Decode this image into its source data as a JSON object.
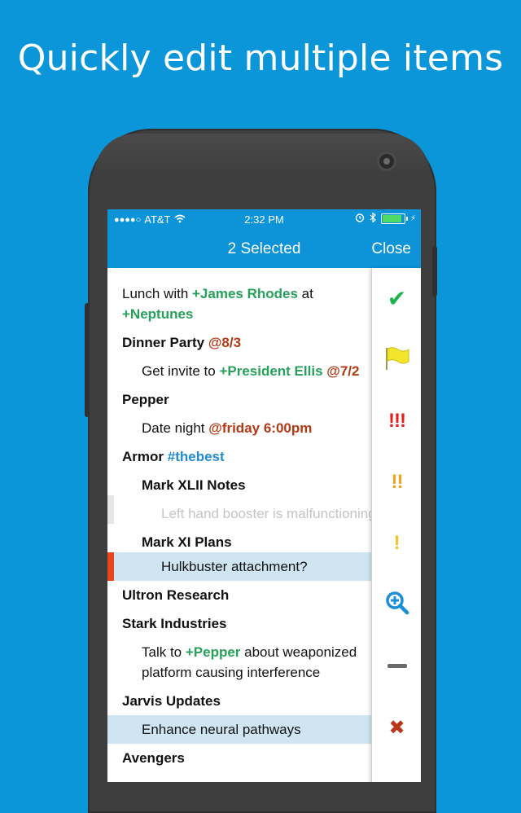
{
  "headline": "Quickly edit multiple items",
  "status": {
    "carrier": "AT&T",
    "time": "2:32 PM",
    "battery_level": 0.9,
    "signal_icon": "signal-dots-icon",
    "wifi_icon": "wifi-icon",
    "alarm_icon": "alarm-icon",
    "bluetooth_icon": "bluetooth-icon"
  },
  "nav": {
    "title": "2 Selected",
    "close": "Close"
  },
  "colors": {
    "accent": "#0c93d8",
    "background": "#0a96d9",
    "contact": "#26a05a",
    "date": "#b13a14",
    "tag": "#1f8bd0",
    "selected_row": "#cfe6f2",
    "marker": "#e8451e"
  },
  "items": {
    "r0": {
      "a": "Lunch with ",
      "b": "+James Rhodes",
      "c": " at"
    },
    "r0b": {
      "a": "+Neptunes"
    },
    "r1": {
      "a": "Dinner Party ",
      "b": "@8/3"
    },
    "r2": {
      "a": "Get invite to ",
      "b": "+President Ellis",
      "c": " @7/2"
    },
    "r3": {
      "a": "Pepper"
    },
    "r4": {
      "a": "Date night ",
      "b": "@friday 6:00pm"
    },
    "r5": {
      "a": "Armor ",
      "b": "#thebest"
    },
    "r6": {
      "a": "Mark XLII Notes"
    },
    "r7": {
      "a": "Left hand booster is malfunctioning"
    },
    "r8": {
      "a": "Mark XI Plans"
    },
    "r9": {
      "a": "Hulkbuster attachment?"
    },
    "r10": {
      "a": "Ultron Research"
    },
    "r11": {
      "a": "Stark Industries"
    },
    "r12": {
      "a": "Talk to ",
      "b": "+Pepper",
      "c": " about weaponized"
    },
    "r12b": {
      "a": "platform causing interference"
    },
    "r13": {
      "a": "Jarvis Updates"
    },
    "r14": {
      "a": "Enhance neural pathways"
    },
    "r15": {
      "a": "Avengers"
    }
  },
  "sidebar": {
    "check": {
      "icon": "checkmark-icon",
      "symbol": "✔"
    },
    "flag": {
      "icon": "flag-icon"
    },
    "p3": {
      "icon": "priority-high-icon",
      "symbol": "!!!"
    },
    "p2": {
      "icon": "priority-medium-icon",
      "symbol": "!!"
    },
    "p1": {
      "icon": "priority-low-icon",
      "symbol": "!"
    },
    "zoom": {
      "icon": "zoom-in-icon"
    },
    "minus": {
      "icon": "minus-icon"
    },
    "delete": {
      "icon": "delete-icon",
      "symbol": "✖"
    }
  }
}
